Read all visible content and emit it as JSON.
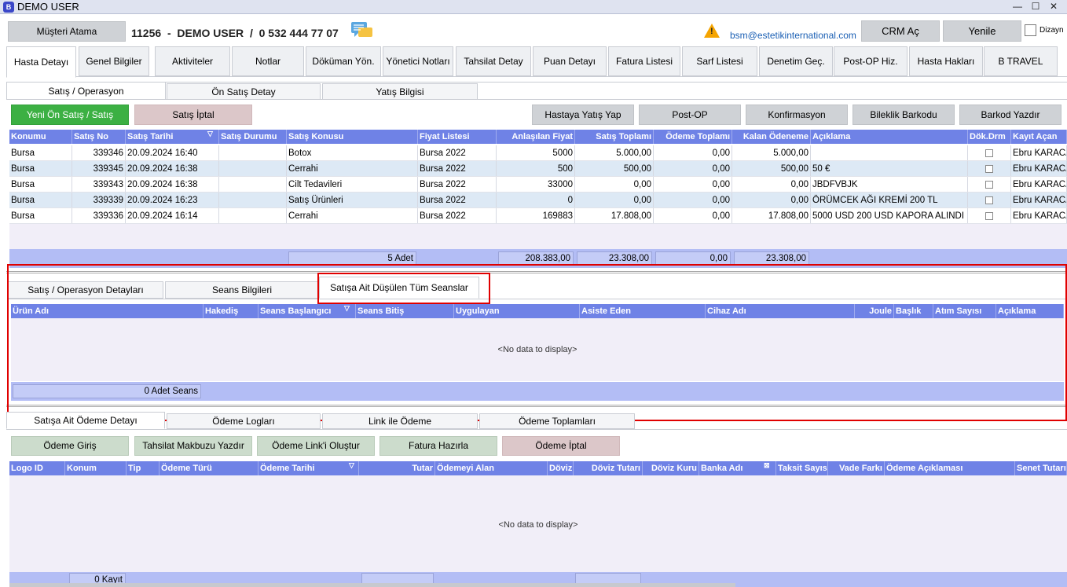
{
  "window": {
    "title": "DEMO USER",
    "app_icon": "B",
    "minimize": "—",
    "maximize": "☐",
    "close": "✕"
  },
  "header": {
    "musteri_atama": "Müşteri Atama",
    "patient_info": "11256  -  DEMO USER  /  0 532 444 77 07",
    "email": "bsm@estetikinternational.com",
    "crm_btn": "CRM Aç",
    "refresh_btn": "Yenile",
    "layout_label": "Dizayn"
  },
  "main_tabs": [
    "Hasta Detayı",
    "Genel Bilgiler",
    "Aktiviteler",
    "Notlar",
    "Döküman Yön.",
    "Yönetici Notları",
    "Tahsilat Detay",
    "Puan Detayı",
    "Fatura Listesi",
    "Sarf Listesi",
    "Denetim Geç.",
    "Post-OP Hiz.",
    "Hasta Hakları",
    "B TRAVEL"
  ],
  "sub_tabs": [
    "Satış / Operasyon",
    "Ön Satış Detay",
    "Yatış Bilgisi"
  ],
  "toolbar": {
    "new_sale": "Yeni Ön Satış / Satış",
    "cancel_sale": "Satış İptal",
    "hospitalize": "Hastaya Yatış Yap",
    "post_op": "Post-OP",
    "confirmation": "Konfirmasyon",
    "bracelet": "Bileklik Barkodu",
    "print_barcode": "Barkod Yazdır"
  },
  "sales_grid": {
    "columns": [
      "Konumu",
      "Satış No",
      "Satış Tarihi",
      "Satış Durumu",
      "Satış Konusu",
      "Fiyat Listesi",
      "Anlaşılan Fiyat",
      "Satış Toplamı",
      "Ödeme Toplamı",
      "Kalan Ödeneme",
      "Açıklama",
      "Dök.Drm",
      "Kayıt Açan"
    ],
    "rows": [
      {
        "konum": "Bursa",
        "no": "339346",
        "tarih": "20.09.2024 16:40",
        "durum": "",
        "konu": "Botox",
        "fiyat_listesi": "Bursa 2022",
        "anlasilan": "5000",
        "satis_toplami": "5.000,00",
        "odeme_toplami": "0,00",
        "kalan": "5.000,00",
        "aciklama": "",
        "kayit": "Ebru KARACA"
      },
      {
        "konum": "Bursa",
        "no": "339345",
        "tarih": "20.09.2024 16:38",
        "durum": "",
        "konu": "Cerrahi",
        "fiyat_listesi": "Bursa 2022",
        "anlasilan": "500",
        "satis_toplami": "500,00",
        "odeme_toplami": "0,00",
        "kalan": "500,00",
        "aciklama": "50 €",
        "kayit": "Ebru KARACA"
      },
      {
        "konum": "Bursa",
        "no": "339343",
        "tarih": "20.09.2024 16:38",
        "durum": "",
        "konu": "Cilt Tedavileri",
        "fiyat_listesi": "Bursa 2022",
        "anlasilan": "33000",
        "satis_toplami": "0,00",
        "odeme_toplami": "0,00",
        "kalan": "0,00",
        "aciklama": "JBDFVBJK",
        "kayit": "Ebru KARACA"
      },
      {
        "konum": "Bursa",
        "no": "339339",
        "tarih": "20.09.2024 16:23",
        "durum": "",
        "konu": "Satış Ürünleri",
        "fiyat_listesi": "Bursa 2022",
        "anlasilan": "0",
        "satis_toplami": "0,00",
        "odeme_toplami": "0,00",
        "kalan": "0,00",
        "aciklama": "ÖRÜMCEK AĞI KREMİ 200 TL",
        "kayit": "Ebru KARACA"
      },
      {
        "konum": "Bursa",
        "no": "339336",
        "tarih": "20.09.2024 16:14",
        "durum": "",
        "konu": "Cerrahi",
        "fiyat_listesi": "Bursa 2022",
        "anlasilan": "169883",
        "satis_toplami": "17.808,00",
        "odeme_toplami": "0,00",
        "kalan": "17.808,00",
        "aciklama": "5000 USD 200 USD KAPORA ALINDI",
        "kayit": "Ebru KARACA"
      }
    ],
    "summary": {
      "count": "5 Adet",
      "anlasilan": "208.383,00",
      "satis": "23.308,00",
      "odeme": "0,00",
      "kalan": "23.308,00"
    }
  },
  "session_tabs": [
    "Satış / Operasyon Detayları",
    "Seans Bilgileri",
    "Satışa Ait Düşülen Tüm Seanslar"
  ],
  "session_grid": {
    "columns": [
      "Ürün Adı",
      "Hakediş",
      "Seans Başlangıcı",
      "Seans Bitiş",
      "Uygulayan",
      "Asiste Eden",
      "Cihaz Adı",
      "Joule",
      "Başlık",
      "Atım Sayısı",
      "Açıklama"
    ],
    "no_data": "<No data to display>",
    "summary": "0 Adet Seans"
  },
  "payment_tabs": [
    "Satışa Ait Ödeme Detayı",
    "Ödeme Logları",
    "Link ile Ödeme",
    "Ödeme Toplamları"
  ],
  "payment_toolbar": {
    "entry": "Ödeme Giriş",
    "receipt": "Tahsilat Makbuzu Yazdır",
    "link": "Ödeme Link'i Oluştur",
    "invoice": "Fatura Hazırla",
    "cancel": "Ödeme İptal"
  },
  "payment_grid": {
    "columns": [
      "Logo ID",
      "Konum",
      "Tip",
      "Ödeme Türü",
      "Ödeme Tarihi",
      "Tutar",
      "Ödemeyi Alan",
      "Döviz",
      "Döviz Tutarı",
      "Döviz Kuru",
      "Banka Adı",
      "Taksit Sayısı",
      "Vade Farkı",
      "Ödeme Açıklaması",
      "Senet Tutarı"
    ],
    "no_data": "<No data to display>",
    "summary": "0 Kayıt"
  },
  "colors": {
    "grid_header": "#6f82e6",
    "new_sale_btn": "#3cb043",
    "cancel_btn": "#dcc7c9",
    "highlight": "#e00000"
  }
}
